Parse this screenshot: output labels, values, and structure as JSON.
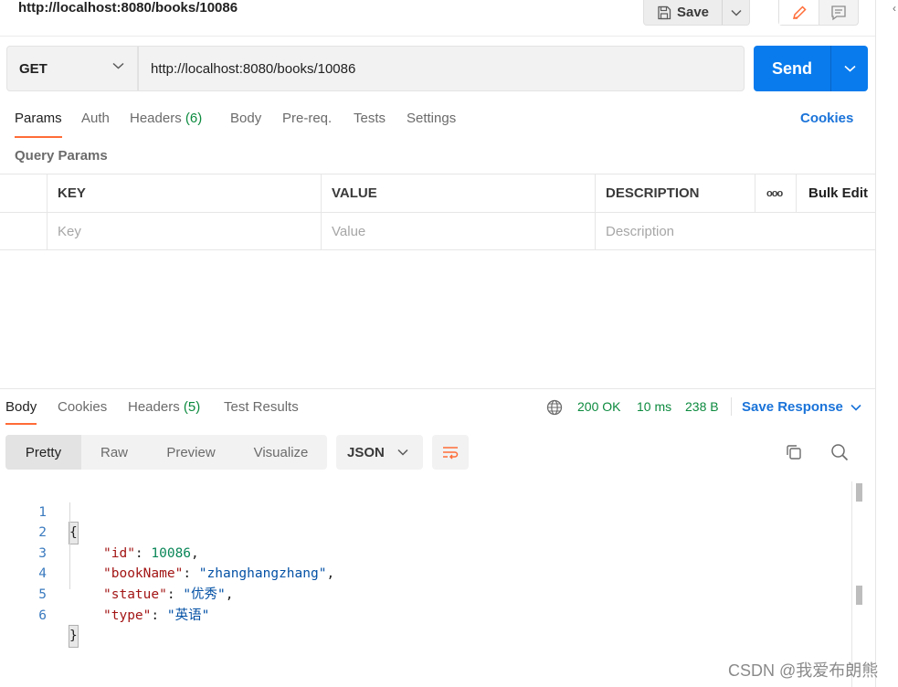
{
  "header": {
    "title": "http://localhost:8080/books/10086",
    "save_label": "Save"
  },
  "request": {
    "method": "GET",
    "url": "http://localhost:8080/books/10086",
    "send_label": "Send"
  },
  "request_tabs": [
    {
      "label": "Params"
    },
    {
      "label": "Auth"
    },
    {
      "label": "Headers",
      "count": "(6)"
    },
    {
      "label": "Body"
    },
    {
      "label": "Pre-req."
    },
    {
      "label": "Tests"
    },
    {
      "label": "Settings"
    }
  ],
  "cookies_link": "Cookies",
  "query_params": {
    "title": "Query Params",
    "columns": {
      "key": "KEY",
      "value": "VALUE",
      "description": "DESCRIPTION",
      "more": "ooo",
      "bulk_edit": "Bulk Edit"
    },
    "placeholders": {
      "key": "Key",
      "value": "Value",
      "description": "Description"
    }
  },
  "response_tabs": [
    {
      "label": "Body"
    },
    {
      "label": "Cookies"
    },
    {
      "label": "Headers",
      "count": "(5)"
    },
    {
      "label": "Test Results"
    }
  ],
  "response_status": {
    "status": "200 OK",
    "time": "10 ms",
    "size": "238 B",
    "save_response": "Save Response"
  },
  "format": {
    "modes": [
      "Pretty",
      "Raw",
      "Preview",
      "Visualize"
    ],
    "language": "JSON"
  },
  "code_lines": [
    {
      "n": "1"
    },
    {
      "n": "2",
      "key": "\"id\"",
      "val": "10086"
    },
    {
      "n": "3",
      "key": "\"bookName\"",
      "val": "\"zhanghangzhang\""
    },
    {
      "n": "4",
      "key": "\"statue\"",
      "val": "\"优秀\""
    },
    {
      "n": "5",
      "key": "\"type\"",
      "val": "\"英语\""
    },
    {
      "n": "6"
    }
  ],
  "watermark": "CSDN @我爱布朗熊",
  "colors": {
    "accent": "#097bed",
    "tab_indicator": "#ff6c37",
    "success": "#0c8a3e",
    "link": "#1a73d9"
  }
}
